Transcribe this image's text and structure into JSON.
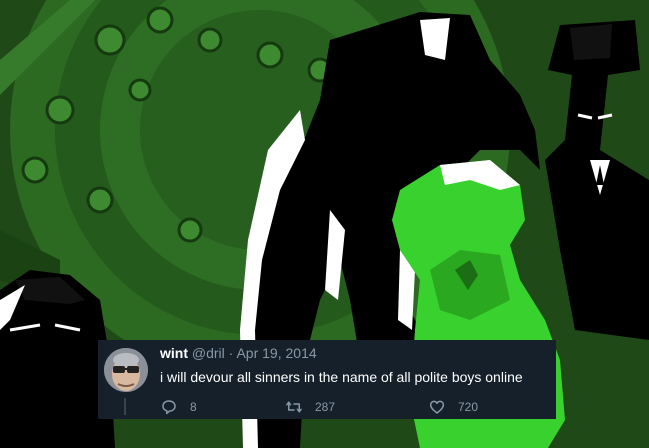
{
  "tweet": {
    "display_name": "wint",
    "handle": "@dril",
    "separator": "·",
    "date": "Apr 19, 2014",
    "text": "i will devour all sinners in the name of all polite boys online",
    "reply_count": "8",
    "retweet_count": "287",
    "like_count": "720"
  },
  "icons": {
    "reply": "reply-icon",
    "retweet": "retweet-icon",
    "like": "heart-icon"
  },
  "colors": {
    "tweet_background": "#15202b",
    "muted_text": "#8899a6",
    "background_tint": "#2e6b24",
    "bright_green": "#39d12d"
  }
}
